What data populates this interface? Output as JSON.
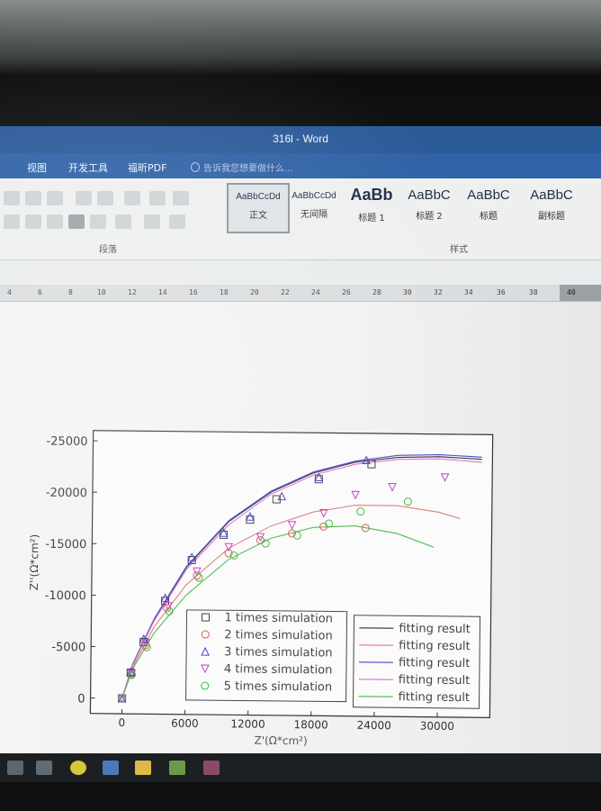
{
  "window": {
    "title": "316l - Word"
  },
  "menu": {
    "items": [
      "视图",
      "开发工具",
      "福昕PDF"
    ],
    "tell_me": "告诉我您想要做什么..."
  },
  "ribbon": {
    "paragraph_group_label": "段落",
    "styles_group_label": "样式",
    "styles": [
      {
        "sample": "AaBbCcDd",
        "name": "正文"
      },
      {
        "sample": "AaBbCcDd",
        "name": "无间隔"
      },
      {
        "sample": "AaBb",
        "name": "标题 1"
      },
      {
        "sample": "AaBbC",
        "name": "标题 2"
      },
      {
        "sample": "AaBbC",
        "name": "标题"
      },
      {
        "sample": "AaBbC",
        "name": "副标题"
      }
    ]
  },
  "ruler": {
    "numbers": [
      "4",
      "6",
      "8",
      "10",
      "12",
      "14",
      "16",
      "18",
      "20",
      "22",
      "24",
      "26",
      "28",
      "30",
      "32",
      "34",
      "36",
      "38",
      "40"
    ]
  },
  "colors": {
    "titlebar": "#2c5b9a",
    "menubar": "#2f62a6"
  },
  "chart_data": {
    "type": "scatter",
    "xlabel": "Z'(Ω*cm²)",
    "ylabel": "Z''(Ω*cm²)",
    "xlim": [
      -3000,
      35000
    ],
    "ylim": [
      1500,
      -26000
    ],
    "x_ticks": [
      0,
      6000,
      12000,
      18000,
      24000,
      30000
    ],
    "y_ticks": [
      -25000,
      -20000,
      -15000,
      -10000,
      -5000,
      0
    ],
    "legend_position": "bottom-center",
    "series": [
      {
        "name": "1 times simulation",
        "marker": "square",
        "color": "#3a3a3a",
        "x": [
          0,
          800,
          2000,
          4000,
          6500,
          9500,
          12000,
          14500,
          18500,
          23500
        ],
        "y": [
          0,
          -2500,
          -5500,
          -9500,
          -13500,
          -16000,
          -17500,
          -19500,
          -21500,
          -23000
        ]
      },
      {
        "name": "2 times simulation",
        "marker": "circle",
        "color": "#d45a4a",
        "x": [
          0,
          900,
          2200,
          4200,
          7000,
          10000,
          13000,
          16000,
          19000,
          23000
        ],
        "y": [
          0,
          -2300,
          -5200,
          -8800,
          -12000,
          -14200,
          -15500,
          -16200,
          -16900,
          -16800
        ]
      },
      {
        "name": "3 times simulation",
        "marker": "triangle-up",
        "color": "#3a3ac8",
        "x": [
          0,
          800,
          2000,
          4000,
          6500,
          9500,
          12000,
          15000,
          18500,
          23000
        ],
        "y": [
          0,
          -2600,
          -5800,
          -9800,
          -13800,
          -16200,
          -17800,
          -19800,
          -21700,
          -23400
        ]
      },
      {
        "name": "4 times simulation",
        "marker": "triangle-down",
        "color": "#c83ac8",
        "x": [
          0,
          900,
          2200,
          4300,
          7000,
          10000,
          13000,
          16000,
          19000,
          22000,
          25500,
          30500
        ],
        "y": [
          0,
          -2400,
          -5400,
          -9000,
          -12400,
          -14800,
          -15800,
          -17000,
          -18200,
          -20000,
          -20800,
          -21800
        ]
      },
      {
        "name": "5 times simulation",
        "marker": "circle",
        "color": "#3ab83a",
        "x": [
          0,
          900,
          2300,
          4400,
          7200,
          10500,
          13500,
          16500,
          19500,
          22500,
          27000
        ],
        "y": [
          0,
          -2300,
          -5000,
          -8500,
          -11800,
          -14000,
          -15200,
          -16000,
          -17200,
          -18400,
          -19400
        ]
      }
    ],
    "fits": [
      {
        "name": "fitting result",
        "color": "#2c2c2c",
        "x": [
          0,
          1000,
          3000,
          6000,
          10000,
          14000,
          18000,
          22000,
          26000,
          30000,
          34000
        ],
        "y": [
          0,
          -3300,
          -7700,
          -12800,
          -17300,
          -20200,
          -22100,
          -23200,
          -23700,
          -23800,
          -23600
        ]
      },
      {
        "name": "fitting result",
        "color": "#e07a7a",
        "x": [
          0,
          1000,
          3000,
          6000,
          10000,
          14000,
          18000,
          22000,
          26000,
          30000,
          32000
        ],
        "y": [
          0,
          -3100,
          -7000,
          -11100,
          -14700,
          -16900,
          -18300,
          -19000,
          -19000,
          -18400,
          -17800
        ]
      },
      {
        "name": "fitting result",
        "color": "#4a4ad0",
        "x": [
          0,
          1000,
          3000,
          6000,
          10000,
          14000,
          18000,
          22000,
          26000,
          30000,
          34000
        ],
        "y": [
          0,
          -3400,
          -7800,
          -12900,
          -17400,
          -20300,
          -22200,
          -23300,
          -23900,
          -24000,
          -23800
        ]
      },
      {
        "name": "fitting result",
        "color": "#d070d0",
        "x": [
          0,
          1000,
          3000,
          6000,
          10000,
          14000,
          18000,
          22000,
          26000,
          30000,
          34000
        ],
        "y": [
          0,
          -3300,
          -7600,
          -12600,
          -17000,
          -20000,
          -21900,
          -23000,
          -23500,
          -23600,
          -23300
        ]
      },
      {
        "name": "fitting result",
        "color": "#4ab84a",
        "x": [
          0,
          1000,
          3000,
          6000,
          10000,
          14000,
          18000,
          22000,
          26000,
          29500
        ],
        "y": [
          0,
          -2900,
          -6400,
          -10100,
          -13600,
          -15700,
          -16800,
          -17000,
          -16300,
          -15000
        ]
      }
    ]
  }
}
